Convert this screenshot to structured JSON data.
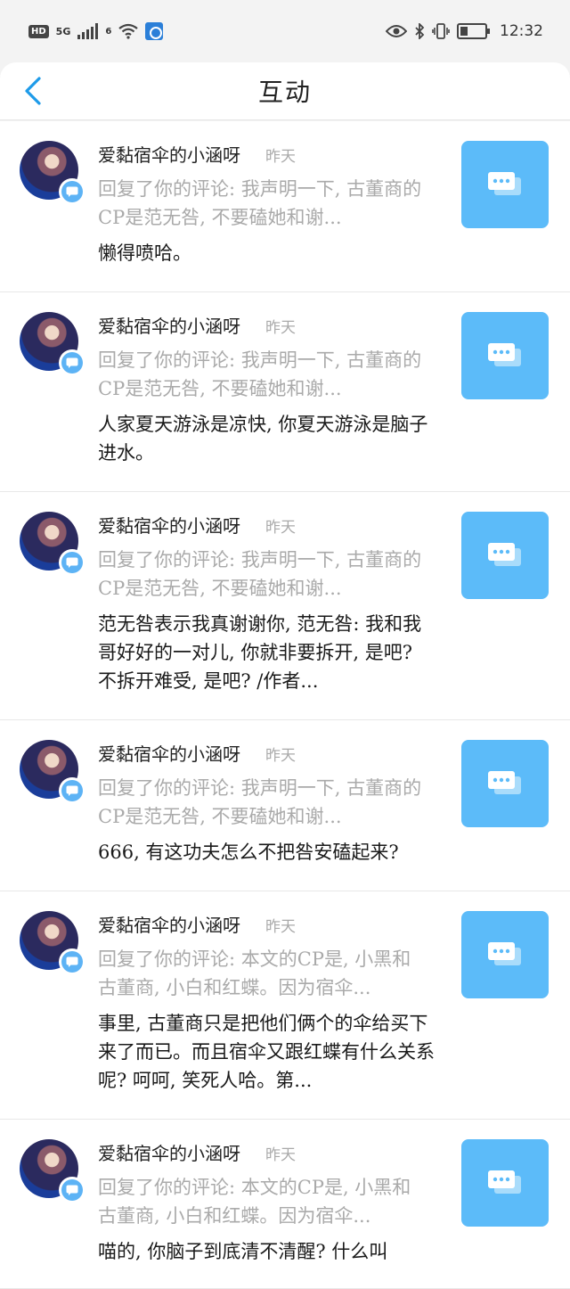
{
  "status_bar": {
    "hd": "HD",
    "network": "5G",
    "wifi_label": "6",
    "time": "12:32"
  },
  "header": {
    "title": "互动"
  },
  "items": [
    {
      "name": "爱黏宿伞的小涵呀",
      "time": "昨天",
      "quote": "回复了你的评论: 我声明一下, 古董商的CP是范无咎, 不要磕她和谢...",
      "comment": "懒得喷哈。"
    },
    {
      "name": "爱黏宿伞的小涵呀",
      "time": "昨天",
      "quote": "回复了你的评论: 我声明一下, 古董商的CP是范无咎, 不要磕她和谢...",
      "comment": "人家夏天游泳是凉快, 你夏天游泳是脑子进水。"
    },
    {
      "name": "爱黏宿伞的小涵呀",
      "time": "昨天",
      "quote": "回复了你的评论: 我声明一下, 古董商的CP是范无咎, 不要磕她和谢...",
      "comment": "范无咎表示我真谢谢你, 范无咎: 我和我哥好好的一对儿, 你就非要拆开, 是吧? 不拆开难受, 是吧? /作者..."
    },
    {
      "name": "爱黏宿伞的小涵呀",
      "time": "昨天",
      "quote": "回复了你的评论: 我声明一下, 古董商的CP是范无咎, 不要磕她和谢...",
      "comment": "666, 有这功夫怎么不把咎安磕起来?"
    },
    {
      "name": "爱黏宿伞的小涵呀",
      "time": "昨天",
      "quote": "回复了你的评论: 本文的CP是, 小黑和古董商, 小白和红蝶。因为宿伞...",
      "comment": "事里, 古董商只是把他们俩个的伞给买下来了而已。而且宿伞又跟红蝶有什么关系呢? 呵呵, 笑死人哈。第..."
    },
    {
      "name": "爱黏宿伞的小涵呀",
      "time": "昨天",
      "quote": "回复了你的评论: 本文的CP是, 小黑和古董商, 小白和红蝶。因为宿伞...",
      "comment": "喵的, 你脑子到底清不清醒? 什么叫"
    }
  ]
}
